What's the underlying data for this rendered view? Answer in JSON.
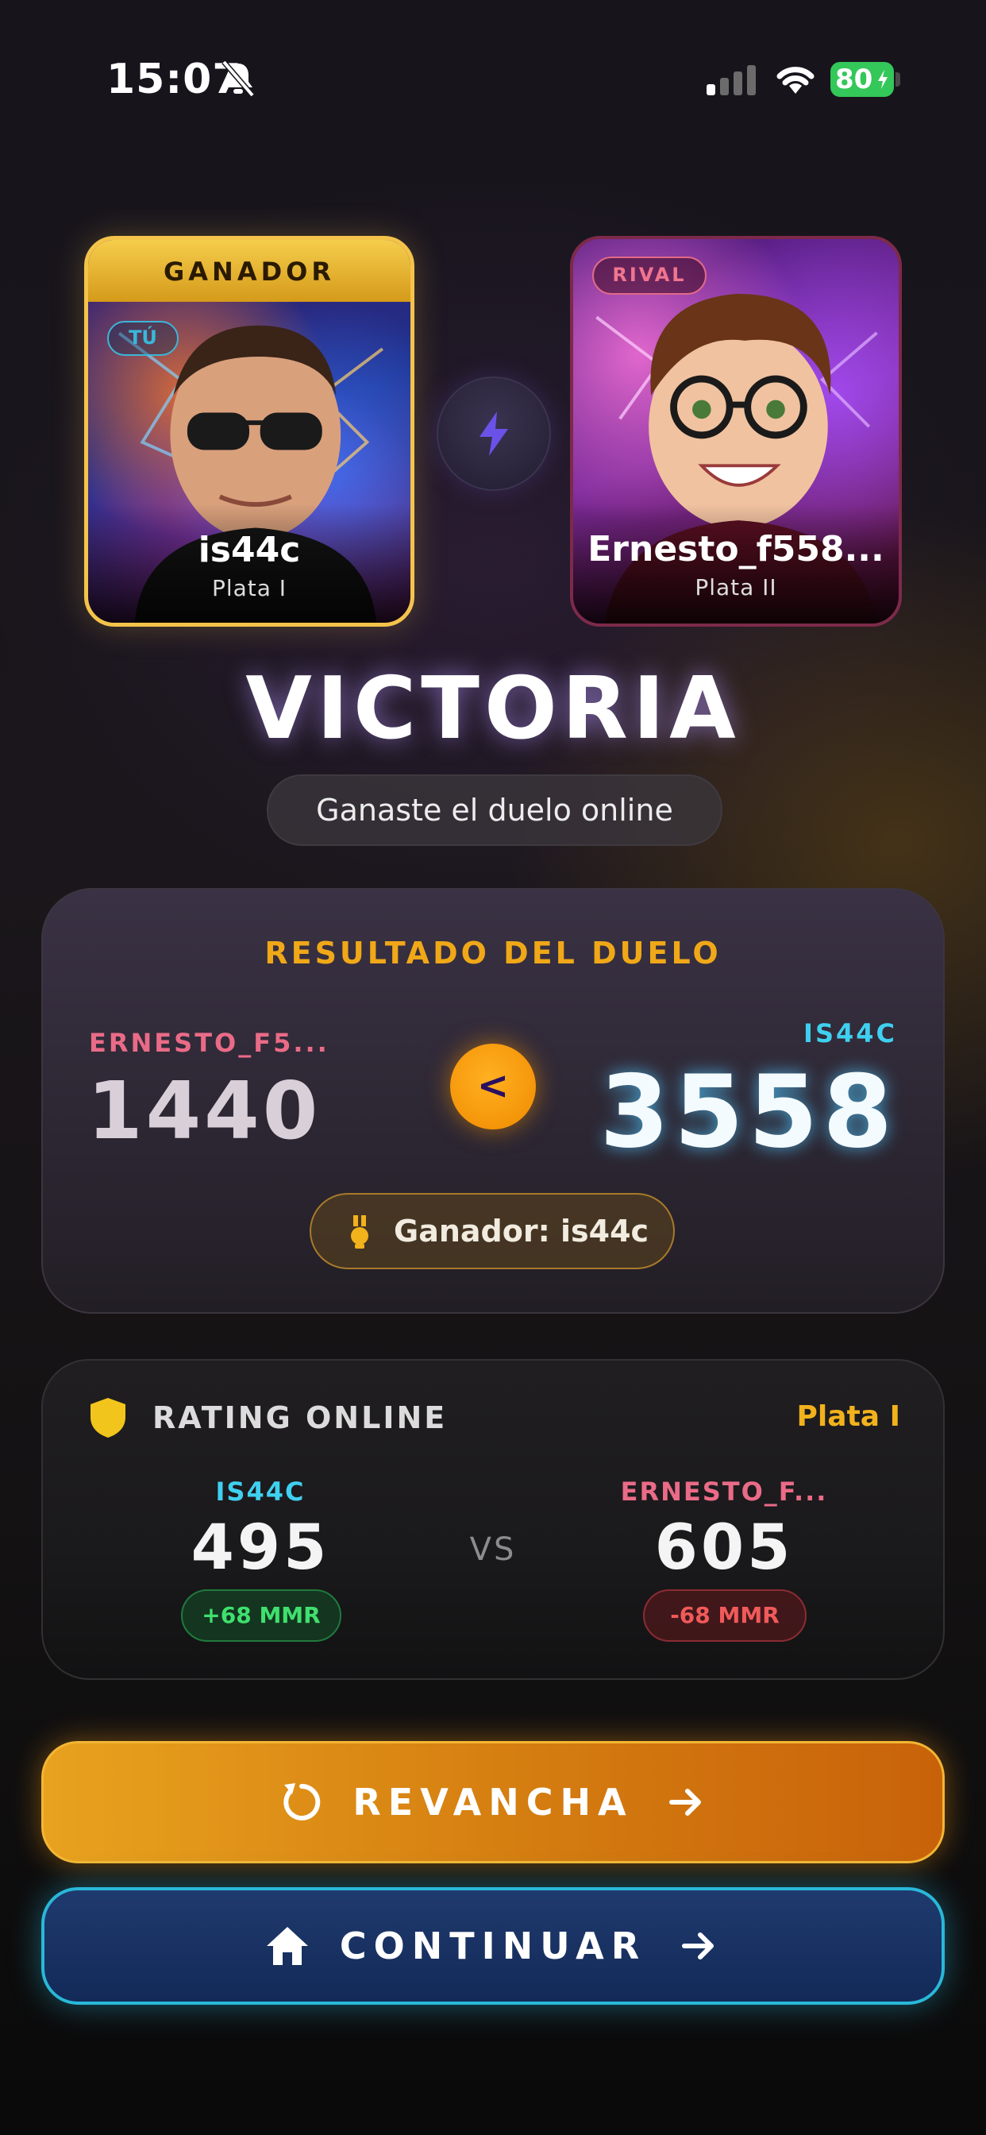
{
  "status_bar": {
    "time": "15:07",
    "battery": "80"
  },
  "players": {
    "you": {
      "banner": "GANADOR",
      "tag": "TÚ",
      "name": "is44c",
      "rank": "Plata I"
    },
    "rival": {
      "tag": "RIVAL",
      "name": "Ernesto_f558...",
      "rank": "Plata II"
    }
  },
  "result": {
    "title": "VICTORIA",
    "subtitle": "Ganaste el duelo online"
  },
  "duel": {
    "title": "RESULTADO DEL DUELO",
    "opponent_label": "ERNESTO_F5...",
    "opponent_score": "1440",
    "comparison": "<",
    "me_label": "IS44C",
    "me_score": "3558",
    "winner_text": "Ganador: is44c"
  },
  "rating": {
    "title": "RATING ONLINE",
    "rank": "Plata I",
    "me_label": "IS44C",
    "me_value": "495",
    "me_delta": "+68 MMR",
    "vs": "VS",
    "opponent_label": "ERNESTO_F...",
    "opponent_value": "605",
    "opponent_delta": "-68 MMR"
  },
  "buttons": {
    "rematch": "REVANCHA",
    "continue": "CONTINUAR"
  },
  "colors": {
    "gold": "#f0a818",
    "cyan": "#3fd0f0",
    "pink": "#ea6b87",
    "green": "#3fe06e",
    "red": "#f05a5a"
  }
}
